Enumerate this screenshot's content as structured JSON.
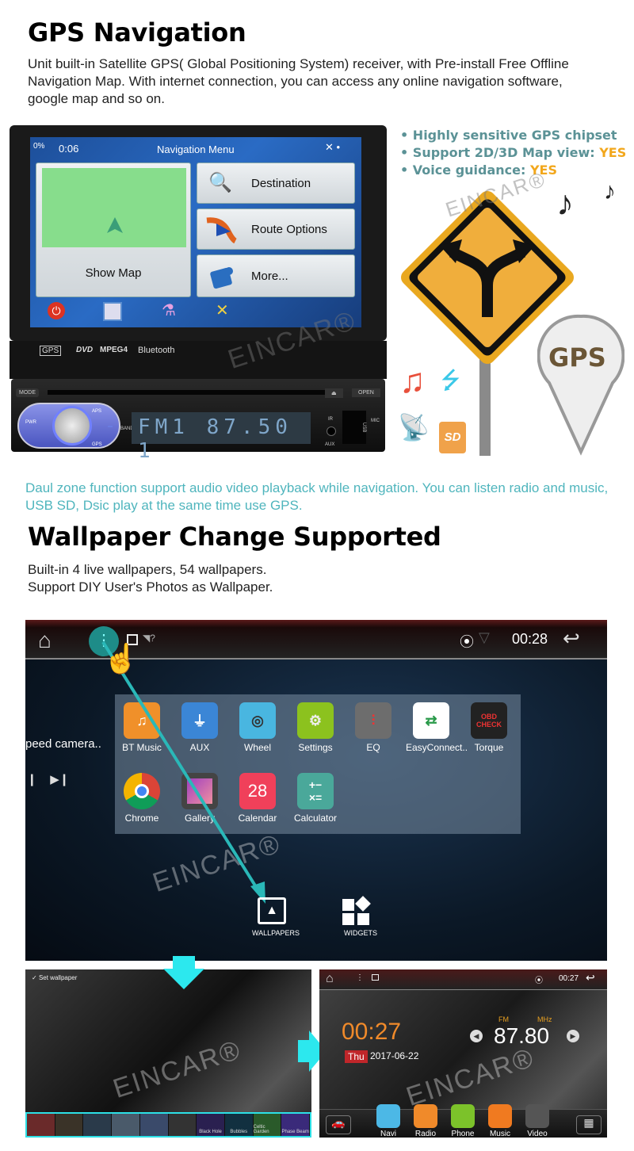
{
  "gps_section": {
    "title": "GPS Navigation",
    "description": "Unit built-in Satellite GPS( Global Positioning System) receiver, with Pre-install Free Offline Navigation Map.  With internet connection, you can access any online navigation software, google map and so on.",
    "features": [
      {
        "text": "Highly sensitive GPS chipset",
        "value": ""
      },
      {
        "text": "Support 2D/3D Map view: ",
        "value": "YES"
      },
      {
        "text": "Voice guidance: ",
        "value": "YES"
      }
    ],
    "pin_label": "GPS",
    "sd_label": "SD"
  },
  "head_unit": {
    "screen": {
      "time": "0:06",
      "battery": "0%",
      "title": "Navigation Menu",
      "show_map_label": "Show Map",
      "menu_items": [
        {
          "label": "Destination",
          "icon": "magnifier-icon"
        },
        {
          "label": "Route Options",
          "icon": "route-icon"
        },
        {
          "label": "More...",
          "icon": "puzzle-icon"
        }
      ],
      "bottom_icons": [
        "power-icon",
        "traffic-icon",
        "flask-icon",
        "tools-icon"
      ]
    },
    "logos": [
      "GPS",
      "DVD",
      "MPEG4",
      "Bluetooth"
    ],
    "buttons": {
      "mode": "MODE",
      "open": "OPEN",
      "band": "BAND",
      "pwr": "PWR",
      "aps": "APS",
      "gps": "GPS",
      "ir": "IR",
      "aux": "AUX",
      "mic": "MIC",
      "usb": "USB"
    },
    "display": "FM1  87.50 1"
  },
  "dual_zone_text": "Daul zone function support audio video playback while navigation. You can listen radio and music, USB SD, Dsic play at the same time use GPS.",
  "wallpaper_section": {
    "title": "Wallpaper Change Supported",
    "description_lines": [
      "Built-in 4 live wallpapers, 54 wallpapers.",
      "Support DIY User's Photos as Wallpaper."
    ]
  },
  "android_main": {
    "time": "00:28",
    "side_text": "peed camera..",
    "apps_row1": [
      {
        "label": "BT Music",
        "color": "#f0902a"
      },
      {
        "label": "AUX",
        "color": "#3b86d6"
      },
      {
        "label": "Wheel",
        "color": "#49b6e0"
      },
      {
        "label": "Settings",
        "color": "#8cc21e"
      },
      {
        "label": "EQ",
        "color": "#6d6d6d"
      },
      {
        "label": "EasyConnect..",
        "color": "#ffffff"
      },
      {
        "label": "Torque",
        "color": "#222222"
      }
    ],
    "apps_row2": [
      {
        "label": "Chrome",
        "color": "#e0e0e0"
      },
      {
        "label": "Gallery",
        "color": "#444444"
      },
      {
        "label": "Calendar",
        "color": "#f0405a",
        "text": "28"
      },
      {
        "label": "Calculator",
        "color": "#4aa89a"
      }
    ],
    "options": [
      {
        "label": "WALLPAPERS"
      },
      {
        "label": "WIDGETS"
      }
    ]
  },
  "wallpaper_picker": {
    "header": "Set wallpaper",
    "thumbs": [
      "",
      "",
      "",
      "",
      "",
      "",
      "Black Hole",
      "Bubbles",
      "Celtic Garden",
      "Phase Beam"
    ]
  },
  "android_home": {
    "time": "00:27",
    "clock": "00:27",
    "day": "Thu",
    "date": "2017-06-22",
    "radio_band": "FM",
    "radio_unit": "MHz",
    "frequency": "87.80",
    "dock": [
      {
        "label": "Navi",
        "color": "#4cb8e6"
      },
      {
        "label": "Radio",
        "color": "#f08a2a"
      },
      {
        "label": "Phone",
        "color": "#7cc22a"
      },
      {
        "label": "Music",
        "color": "#f07a20"
      },
      {
        "label": "Video",
        "color": "#555555"
      }
    ]
  },
  "watermark": "EINCAR®",
  "colors": {
    "accent_teal": "#4fb5bd",
    "yes_orange": "#f2a71c",
    "arrow_cyan": "#2ce0e6",
    "clock_orange": "#f08a2a"
  }
}
